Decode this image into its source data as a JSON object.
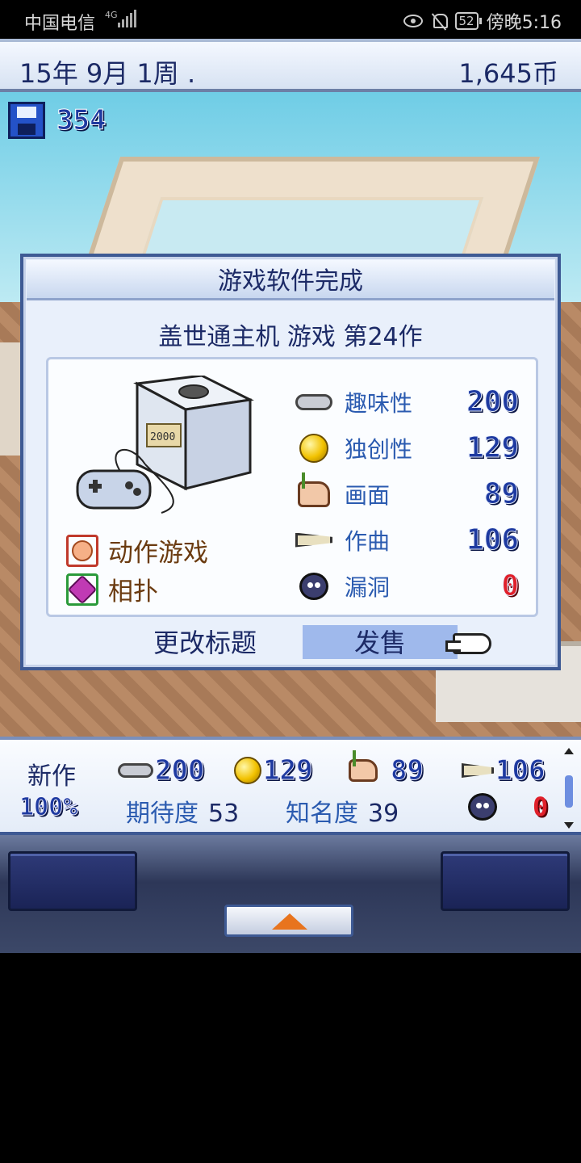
{
  "status_bar": {
    "carrier": "中国电信",
    "network": "4G",
    "battery": "52",
    "time": "傍晚5:16"
  },
  "top_bar": {
    "date": "15年 9月 1周 .",
    "money": "1,645币"
  },
  "save_counter": "354",
  "dialog": {
    "title": "游戏软件完成",
    "game_title": "盖世通主机 游戏 第24作",
    "genres": [
      {
        "label": "动作游戏",
        "icon": "face-icon"
      },
      {
        "label": "相扑",
        "icon": "gem-icon"
      }
    ],
    "stats": [
      {
        "label": "趣味性",
        "value": "200",
        "icon": "gamepad-icon"
      },
      {
        "label": "独创性",
        "value": "129",
        "icon": "coin-icon"
      },
      {
        "label": "画面",
        "value": "89",
        "icon": "palette-icon"
      },
      {
        "label": "作曲",
        "value": "106",
        "icon": "trumpet-icon"
      },
      {
        "label": "漏洞",
        "value": "0",
        "icon": "bug-icon"
      }
    ],
    "rename_label": "更改标题",
    "release_label": "发售"
  },
  "info_bar": {
    "new_label": "新作",
    "progress": "100%",
    "fun": "200",
    "originality": "129",
    "graphics": "89",
    "sound": "106",
    "expectation_label": "期待度",
    "expectation_value": "53",
    "fame_label": "知名度",
    "fame_value": "39",
    "bugs": "0"
  },
  "colors": {
    "accent_blue": "#1e3aa0",
    "bug_red": "#e0202a",
    "release_highlight": "#9fb9ec"
  }
}
